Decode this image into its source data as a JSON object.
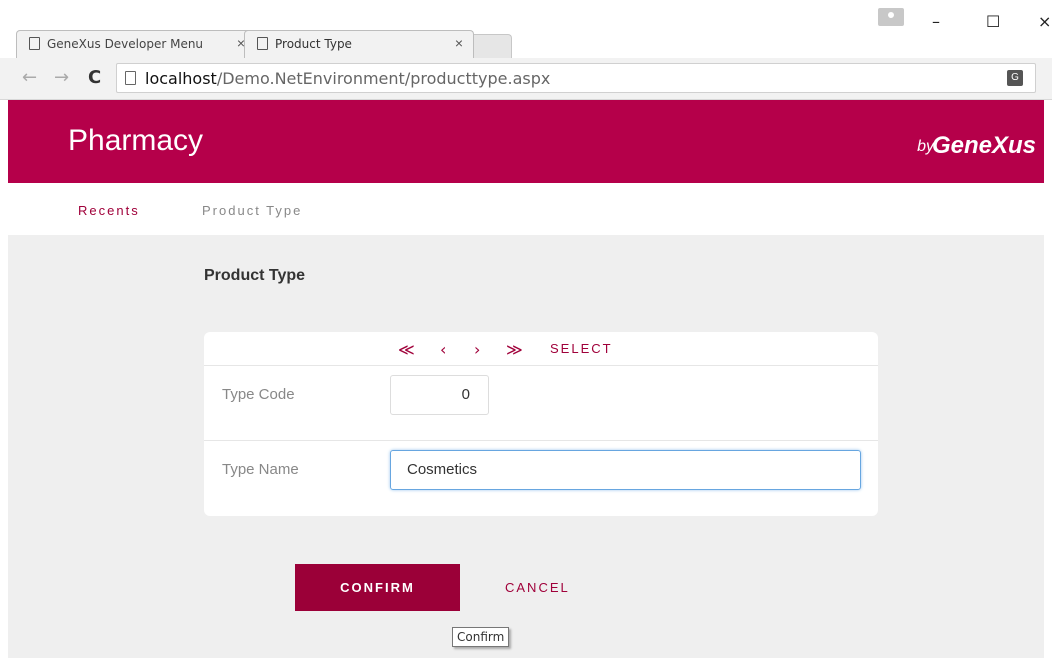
{
  "browser": {
    "tabs": [
      {
        "title": "GeneXus Developer Menu",
        "close": "×"
      },
      {
        "title": "Product Type",
        "close": "×"
      }
    ],
    "url_host": "localhost",
    "url_path": "/Demo.NetEnvironment/producttype.aspx",
    "window_controls": {
      "minimize": "–",
      "maximize": "☐",
      "close": "×"
    },
    "nav": {
      "back": "←",
      "forward": "→",
      "reload": "C"
    }
  },
  "header": {
    "brand": "Pharmacy",
    "by": "by",
    "vendor": "GeneXus",
    "color": "#b5004a"
  },
  "nav": {
    "recents": "Recents",
    "product_type": "Product Type"
  },
  "page": {
    "title": "Product Type",
    "pager": {
      "first": "≪",
      "prev": "‹",
      "next": "›",
      "last": "≫",
      "select": "SELECT"
    },
    "fields": {
      "type_code_label": "Type Code",
      "type_code_value": "0",
      "type_name_label": "Type Name",
      "type_name_value": "Cosmetics"
    },
    "confirm_label": "CONFIRM",
    "cancel_label": "CANCEL",
    "tooltip": "Confirm"
  }
}
